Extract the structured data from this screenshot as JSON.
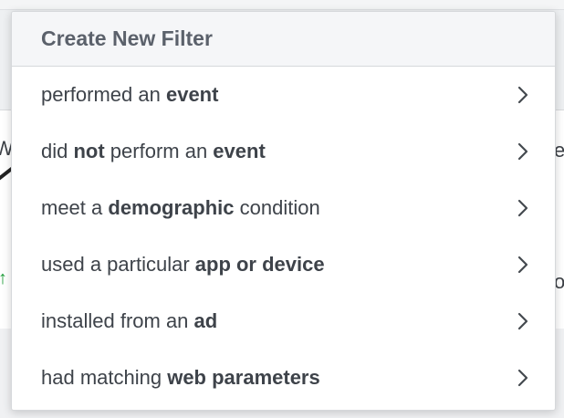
{
  "menu": {
    "title": "Create New Filter",
    "items": [
      {
        "parts": [
          {
            "text": "performed an ",
            "bold": false
          },
          {
            "text": "event",
            "bold": true
          }
        ],
        "icon": "chevron-right-icon"
      },
      {
        "parts": [
          {
            "text": "did ",
            "bold": false
          },
          {
            "text": "not",
            "bold": true
          },
          {
            "text": " perform an ",
            "bold": false
          },
          {
            "text": "event",
            "bold": true
          }
        ],
        "icon": "chevron-right-icon"
      },
      {
        "parts": [
          {
            "text": "meet a ",
            "bold": false
          },
          {
            "text": "demographic",
            "bold": true
          },
          {
            "text": " condition",
            "bold": false
          }
        ],
        "icon": "chevron-right-icon"
      },
      {
        "parts": [
          {
            "text": "used a particular ",
            "bold": false
          },
          {
            "text": "app or device",
            "bold": true
          }
        ],
        "icon": "chevron-right-icon"
      },
      {
        "parts": [
          {
            "text": "installed from an ",
            "bold": false
          },
          {
            "text": "ad",
            "bold": true
          }
        ],
        "icon": "chevron-right-icon"
      },
      {
        "parts": [
          {
            "text": "had matching ",
            "bold": false
          },
          {
            "text": "web parameters",
            "bold": true
          }
        ],
        "icon": "chevron-right-icon"
      }
    ]
  },
  "background": {
    "fragment_left": "W",
    "fragment_right_top": "e",
    "fragment_right_bottom": "o",
    "arrow_glyph": "↑",
    "arrow_color": "#1f9d3a"
  }
}
